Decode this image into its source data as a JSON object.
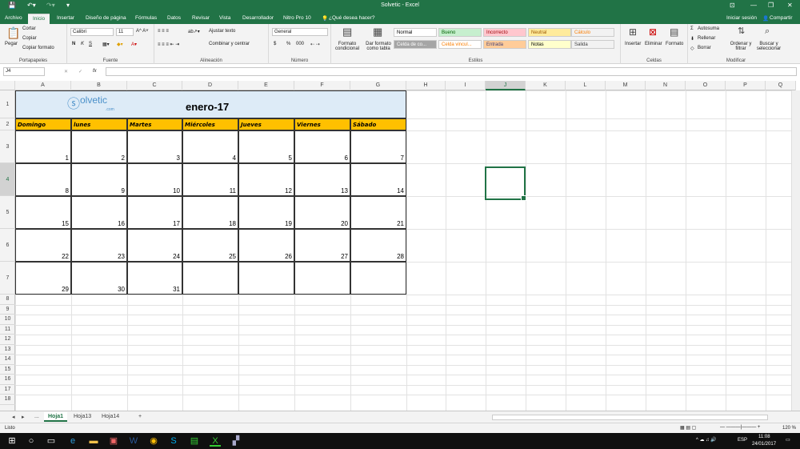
{
  "window": {
    "title": "Solvetic - Excel"
  },
  "titlebar": {
    "save_icon": "save-icon",
    "undo_icon": "undo-icon",
    "redo_icon": "redo-icon",
    "customize_icon": "customize-icon"
  },
  "menu": {
    "tabs": [
      "Archivo",
      "Inicio",
      "Insertar",
      "Diseño de página",
      "Fórmulas",
      "Datos",
      "Revisar",
      "Vista",
      "Desarrollador",
      "Nitro Pro 10"
    ],
    "tell_me": "¿Qué desea hacer?",
    "signin": "Iniciar sesión",
    "share": "Compartir"
  },
  "ribbon": {
    "clipboard": {
      "label": "Portapapeles",
      "paste": "Pegar",
      "cut": "Cortar",
      "copy": "Copiar",
      "format_painter": "Copiar formato"
    },
    "font": {
      "label": "Fuente",
      "family": "Calibri",
      "size": "11",
      "bold": "N",
      "italic": "K",
      "underline": "S"
    },
    "alignment": {
      "label": "Alineación",
      "wrap": "Ajustar texto",
      "merge": "Combinar y centrar"
    },
    "number": {
      "label": "Número",
      "format": "General",
      "currency": "$",
      "percent": "%",
      "thousands": "000"
    },
    "styles": {
      "label": "Estilos",
      "conditional": "Formato condicional",
      "as_table": "Dar formato como tabla",
      "cells": [
        {
          "name": "Normal",
          "bg": "#ffffff",
          "fg": "#000000"
        },
        {
          "name": "Bueno",
          "bg": "#c6efce",
          "fg": "#006100"
        },
        {
          "name": "Incorrecto",
          "bg": "#ffc7ce",
          "fg": "#9c0006"
        },
        {
          "name": "Neutral",
          "bg": "#ffeb9c",
          "fg": "#9c5700"
        },
        {
          "name": "Cálculo",
          "bg": "#f2f2f2",
          "fg": "#fa7d00"
        },
        {
          "name": "Celda de co...",
          "bg": "#a5a5a5",
          "fg": "#ffffff"
        },
        {
          "name": "Celda vincul...",
          "bg": "#ffffff",
          "fg": "#fa7d00"
        },
        {
          "name": "Entrada",
          "bg": "#ffcc99",
          "fg": "#3f3f76"
        },
        {
          "name": "Notas",
          "bg": "#ffffcc",
          "fg": "#000000"
        },
        {
          "name": "Salida",
          "bg": "#f2f2f2",
          "fg": "#3f3f3f"
        }
      ]
    },
    "cells_group": {
      "label": "Celdas",
      "insert": "Insertar",
      "delete": "Eliminar",
      "format": "Formato"
    },
    "modify": {
      "label": "Modificar",
      "autosum": "Autosuma",
      "fill": "Rellenar",
      "clear": "Borrar",
      "sort": "Ordenar y filtrar",
      "find": "Buscar y seleccionar"
    }
  },
  "formula_bar": {
    "name_box": "J4",
    "value": "",
    "cancel": "✕",
    "enter": "✓",
    "fx": "fx"
  },
  "columns": [
    "A",
    "B",
    "C",
    "D",
    "E",
    "F",
    "G",
    "H",
    "I",
    "J",
    "K",
    "L",
    "M",
    "N",
    "O",
    "P",
    "Q"
  ],
  "selected_column": "J",
  "rows": [
    "1",
    "2",
    "3",
    "4",
    "5",
    "6",
    "7",
    "8",
    "9",
    "10",
    "11",
    "12",
    "13",
    "14",
    "15",
    "16",
    "17",
    "18"
  ],
  "selected_row": "4",
  "calendar": {
    "logo_text": "olvetic",
    "logo_sub": ".com",
    "title": "enero-17",
    "days": [
      "Domingo",
      "lunes",
      "Martes",
      "Miércoles",
      "Jueves",
      "Viernes",
      "Sábado"
    ],
    "weeks": [
      [
        "1",
        "2",
        "3",
        "4",
        "5",
        "6",
        "7"
      ],
      [
        "8",
        "9",
        "10",
        "11",
        "12",
        "13",
        "14"
      ],
      [
        "15",
        "16",
        "17",
        "18",
        "19",
        "20",
        "21"
      ],
      [
        "22",
        "23",
        "24",
        "25",
        "26",
        "27",
        "28"
      ],
      [
        "29",
        "30",
        "31",
        "",
        "",
        "",
        ""
      ]
    ]
  },
  "sheets": {
    "tabs": [
      "...",
      "Hoja1",
      "Hoja13",
      "Hoja14"
    ],
    "active": "Hoja1",
    "add": "+"
  },
  "status": {
    "ready": "Listo",
    "zoom": "120 %"
  },
  "taskbar": {
    "time": "11:08",
    "date": "24/01/2017",
    "lang": "ESP"
  }
}
